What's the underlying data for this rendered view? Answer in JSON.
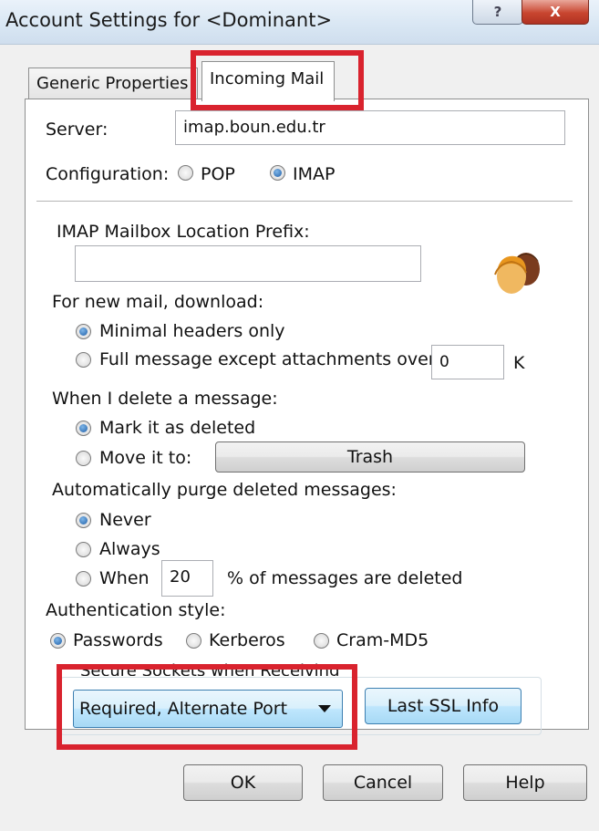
{
  "window": {
    "title": "Account Settings for <Dominant>",
    "help_glyph": "?",
    "close_glyph": "X"
  },
  "tabs": [
    {
      "label": "Generic Properties"
    },
    {
      "label": "Incoming Mail"
    }
  ],
  "server": {
    "label": "Server:",
    "value": "imap.boun.edu.tr"
  },
  "configuration": {
    "label": "Configuration:",
    "options": [
      "POP",
      "IMAP"
    ],
    "selected": "IMAP"
  },
  "imap_prefix": {
    "label": "IMAP Mailbox Location Prefix:",
    "value": ""
  },
  "download": {
    "label": "For new mail, download:",
    "option_minimal": "Minimal headers only",
    "option_full": "Full message except attachments over",
    "size_value": "0",
    "size_unit": "K",
    "selected": "Minimal headers only"
  },
  "delete": {
    "label": "When I delete a message:",
    "option_mark": "Mark it as deleted",
    "option_move": "Move it to:",
    "move_target": "Trash",
    "selected": "Mark it as deleted"
  },
  "purge": {
    "label": "Automatically purge deleted messages:",
    "option_never": "Never",
    "option_always": "Always",
    "option_when": "When",
    "percent_value": "20",
    "percent_suffix": "% of messages are deleted",
    "selected": "Never"
  },
  "auth": {
    "label": "Authentication style:",
    "options": [
      "Passwords",
      "Kerberos",
      "Cram-MD5"
    ],
    "selected": "Passwords"
  },
  "ssl": {
    "label": "Secure Sockets when Receiving",
    "selected": "Required, Alternate Port",
    "info_button": "Last SSL Info"
  },
  "buttons": {
    "ok": "OK",
    "cancel": "Cancel",
    "help": "Help"
  },
  "colors": {
    "highlight": "#d9232e",
    "accent_blue": "#a7d9f5"
  }
}
